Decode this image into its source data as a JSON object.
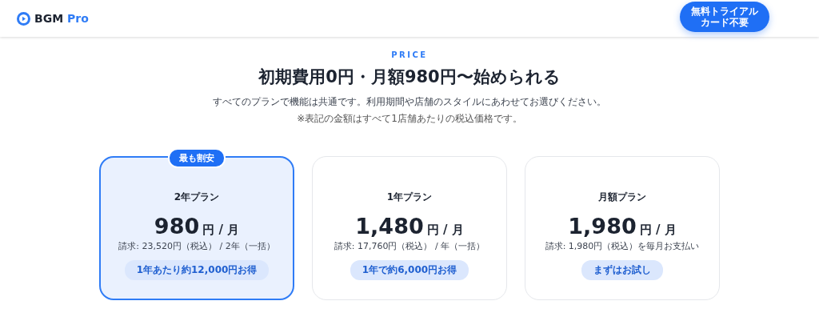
{
  "header": {
    "logo": {
      "brand": "BGM",
      "suffix": "Pro"
    },
    "cta": {
      "title": "無料トライアル",
      "subtitle": "カード不要"
    }
  },
  "section": {
    "eyebrow": "PRICE",
    "title": "初期費用0円・月額980円〜始められる",
    "lead": "すべてのプランで機能は共通です。利用期間や店舗のスタイルにあわせてお選びください。",
    "note": "※表記の金額はすべて1店舗あたりの税込価格です。"
  },
  "plans": [
    {
      "name": "2年プラン",
      "price": "980",
      "unit": "円 / 月",
      "billing": "請求: 23,520円（税込） / 2年（一括）",
      "savings": "1年あたり約12,000円お得",
      "highlighted": true,
      "badge": "最も割安"
    },
    {
      "name": "1年プラン",
      "price": "1,480",
      "unit": "円 / 月",
      "billing": "請求: 17,760円（税込） / 年（一括）",
      "savings": "1年で約6,000円お得",
      "highlighted": false
    },
    {
      "name": "月額プラン",
      "price": "1,980",
      "unit": "円 / 月",
      "billing": "請求: 1,980円（税込）を毎月お支払い",
      "savings": "まずはお試し",
      "highlighted": false
    }
  ]
}
